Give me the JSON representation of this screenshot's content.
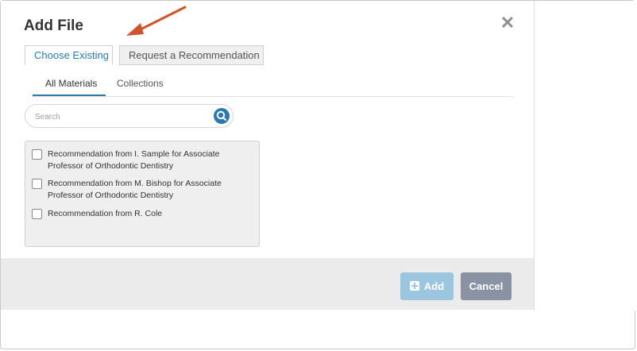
{
  "dialog": {
    "title": "Add File",
    "close_icon": "close-icon"
  },
  "tabs": [
    {
      "label": "Choose Existing",
      "active": true
    },
    {
      "label": "Request a Recommendation",
      "active": false
    }
  ],
  "subtabs": [
    {
      "label": "All Materials",
      "active": true
    },
    {
      "label": "Collections",
      "active": false
    }
  ],
  "search": {
    "placeholder": "Search",
    "icon": "search-icon"
  },
  "materials": [
    {
      "label": "Recommendation from I. Sample for Associate Professor of Orthodontic Dentistry",
      "checked": false
    },
    {
      "label": "Recommendation from M. Bishop for Associate Professor of Orthodontic Dentistry",
      "checked": false
    },
    {
      "label": "Recommendation from R. Cole",
      "checked": false
    }
  ],
  "footer": {
    "add_label": "Add",
    "cancel_label": "Cancel"
  },
  "colors": {
    "accent": "#2a7ab0",
    "arrow": "#d0532b",
    "add_button": "#9cc6e0",
    "cancel_button": "#8a93a3"
  }
}
